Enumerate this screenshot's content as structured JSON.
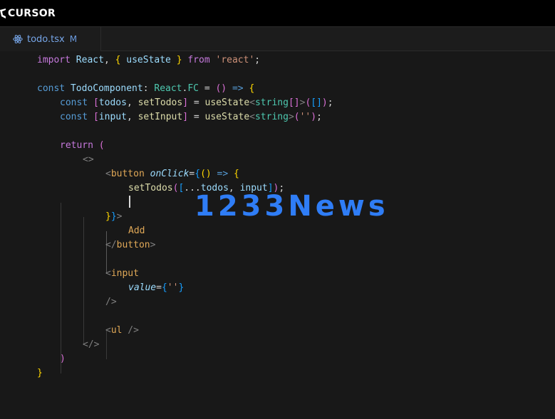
{
  "app": {
    "brand": "CURSOR"
  },
  "tab": {
    "filename": "todo.tsx",
    "status": "M",
    "icon": "react-icon"
  },
  "colors": {
    "background": "#181818",
    "tab_text": "#77a6e8",
    "watermark": "#2f7df6"
  },
  "watermark": {
    "text": "1233News"
  },
  "code": {
    "import_kw": "import",
    "react_ident": "React",
    "use_state": "useState",
    "from_kw": "from",
    "react_module": "'react'",
    "const_kw": "const",
    "component_name": "TodoComponent",
    "react_ns": "React",
    "fc_type": "FC",
    "todos_var": "todos",
    "set_todos": "setTodos",
    "input_var": "input",
    "set_input": "setInput",
    "string_type": "string",
    "empty_string": "''",
    "return_kw": "return",
    "button_tag": "button",
    "onclick_attr": "onClick",
    "spread": "...",
    "add_label": "Add",
    "input_tag": "input",
    "value_attr": "value",
    "ul_tag": "ul"
  }
}
